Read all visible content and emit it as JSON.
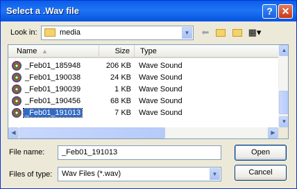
{
  "window": {
    "title": "Select a .Wav file",
    "help_glyph": "?",
    "close_glyph": "✕"
  },
  "lookin": {
    "label": "Look in:",
    "value": "media"
  },
  "toolbar": {
    "back": "back-arrow-icon",
    "up": "up-folder-icon",
    "new": "new-folder-icon",
    "views": "views-menu-icon"
  },
  "columns": {
    "name": "Name",
    "size": "Size",
    "type": "Type"
  },
  "files": [
    {
      "name": "_Feb01_185948",
      "size": "206 KB",
      "type": "Wave Sound",
      "selected": false
    },
    {
      "name": "_Feb01_190038",
      "size": "24 KB",
      "type": "Wave Sound",
      "selected": false
    },
    {
      "name": "_Feb01_190039",
      "size": "1 KB",
      "type": "Wave Sound",
      "selected": false
    },
    {
      "name": "_Feb01_190456",
      "size": "68 KB",
      "type": "Wave Sound",
      "selected": false
    },
    {
      "name": "_Feb01_191013",
      "size": "7 KB",
      "type": "Wave Sound",
      "selected": true
    }
  ],
  "filename": {
    "label": "File name:",
    "value": "_Feb01_191013"
  },
  "filetype": {
    "label": "Files of type:",
    "value": "Wav Files (*.wav)"
  },
  "buttons": {
    "open": "Open",
    "cancel": "Cancel"
  }
}
